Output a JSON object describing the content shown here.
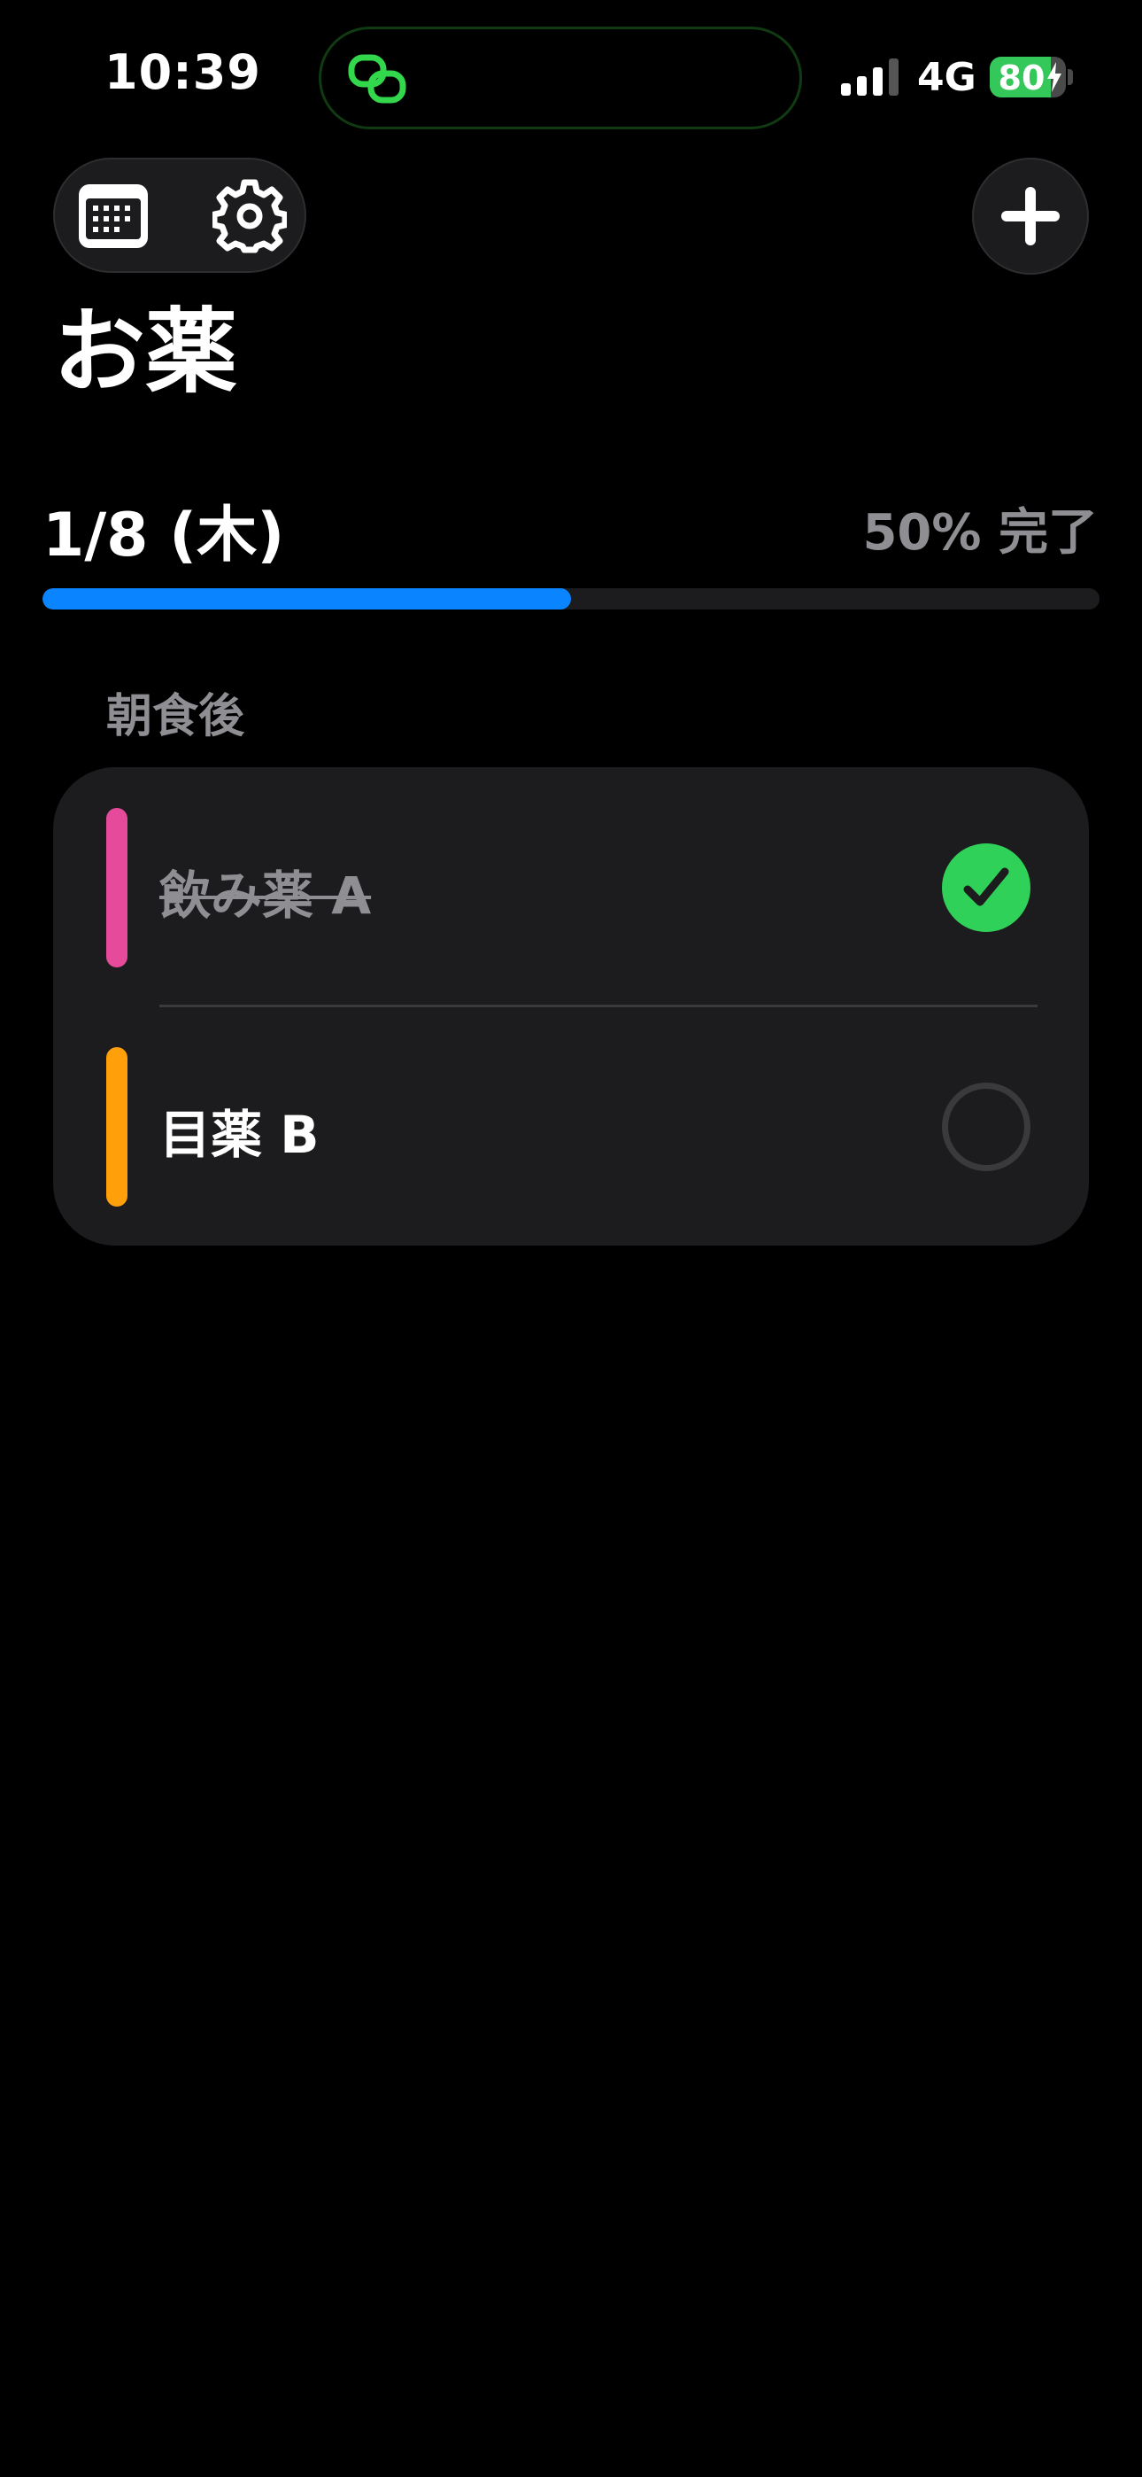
{
  "status_bar": {
    "time": "10:39",
    "network": "4G",
    "battery": "80",
    "battery_level": 0.8
  },
  "icons": {
    "island": "link-icon",
    "calendar": "calendar-icon",
    "settings": "gear-icon",
    "add": "plus-icon"
  },
  "header": {
    "title": "お薬"
  },
  "day": {
    "date": "1/8 (木)",
    "progress_text": "50% 完了",
    "progress": 0.5
  },
  "section": {
    "label": "朝食後",
    "items": [
      {
        "name": "飲み薬 A",
        "color": "#e64b9b",
        "taken": true
      },
      {
        "name": "目薬 B",
        "color": "#ff9f0a",
        "taken": false
      }
    ]
  },
  "colors": {
    "accent": "#0a84ff",
    "done_green": "#30d158",
    "island_green": "#32d74b"
  }
}
